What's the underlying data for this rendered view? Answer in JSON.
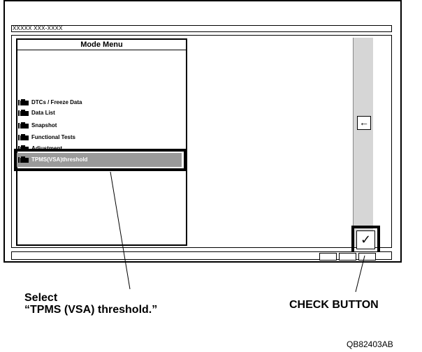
{
  "screen": {
    "title_placeholder": "XXXXX XXX-XXXX"
  },
  "mode_menu": {
    "title": "Mode Menu",
    "items": [
      {
        "label": "DTCs / Freeze Data",
        "icon": "folder-icon"
      },
      {
        "label": "Data List",
        "icon": "folder-icon"
      },
      {
        "label": "Snapshot",
        "icon": "folder-icon"
      },
      {
        "label": "Functional Tests",
        "icon": "folder-icon"
      },
      {
        "label": "Adjustment",
        "icon": "folder-icon"
      }
    ],
    "selected": {
      "label": "TPMS(VSA)threshold",
      "icon": "folder-icon"
    }
  },
  "controls": {
    "back_arrow": "←",
    "check_mark": "✓"
  },
  "callouts": {
    "select_line1": "Select",
    "select_line2": "“TPMS (VSA) threshold.”",
    "check_button": "CHECK BUTTON"
  },
  "figure_code": "QB82403AB",
  "colors": {
    "selection_fill": "#9a9a9a",
    "scrollbar_fill": "#d6d6d6"
  }
}
